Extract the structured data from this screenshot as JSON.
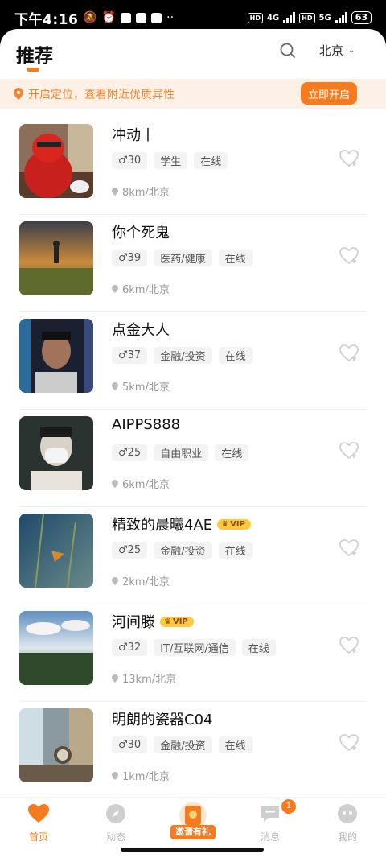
{
  "status_bar": {
    "time": "下午4:16",
    "signal_4g": "4G",
    "signal_5g": "5G",
    "hd": "HD",
    "battery": "63"
  },
  "header": {
    "title": "推荐",
    "city": "北京"
  },
  "banner": {
    "message": "开启定位，查看附近优质异性",
    "button": "立即开启"
  },
  "users": [
    {
      "name": "冲动丨",
      "vip": false,
      "age": "30",
      "tags": [
        "学生",
        "在线"
      ],
      "location": "8km/北京"
    },
    {
      "name": "你个死鬼",
      "vip": false,
      "age": "39",
      "tags": [
        "医药/健康",
        "在线"
      ],
      "location": "6km/北京"
    },
    {
      "name": "点金大人",
      "vip": false,
      "age": "37",
      "tags": [
        "金融/投资",
        "在线"
      ],
      "location": "5km/北京"
    },
    {
      "name": "AIPPS888",
      "vip": false,
      "age": "25",
      "tags": [
        "自由职业",
        "在线"
      ],
      "location": "6km/北京"
    },
    {
      "name": "精致的晨曦4AE",
      "vip": true,
      "age": "25",
      "tags": [
        "金融/投资",
        "在线"
      ],
      "location": "2km/北京"
    },
    {
      "name": "河间滕",
      "vip": true,
      "age": "32",
      "tags": [
        "IT/互联网/通信",
        "在线"
      ],
      "location": "13km/北京"
    },
    {
      "name": "明朗的瓷器C04",
      "vip": false,
      "age": "30",
      "tags": [
        "金融/投资",
        "在线"
      ],
      "location": "1km/北京"
    }
  ],
  "vip_label": "VIP",
  "tabbar": {
    "home": "首页",
    "moments": "动态",
    "invite": "邀请有礼",
    "messages": "消息",
    "messages_badge": "1",
    "mine": "我的"
  },
  "colors": {
    "accent": "#f47b20",
    "banner_bg": "#fdf1e7",
    "vip": "#ffc83d"
  }
}
